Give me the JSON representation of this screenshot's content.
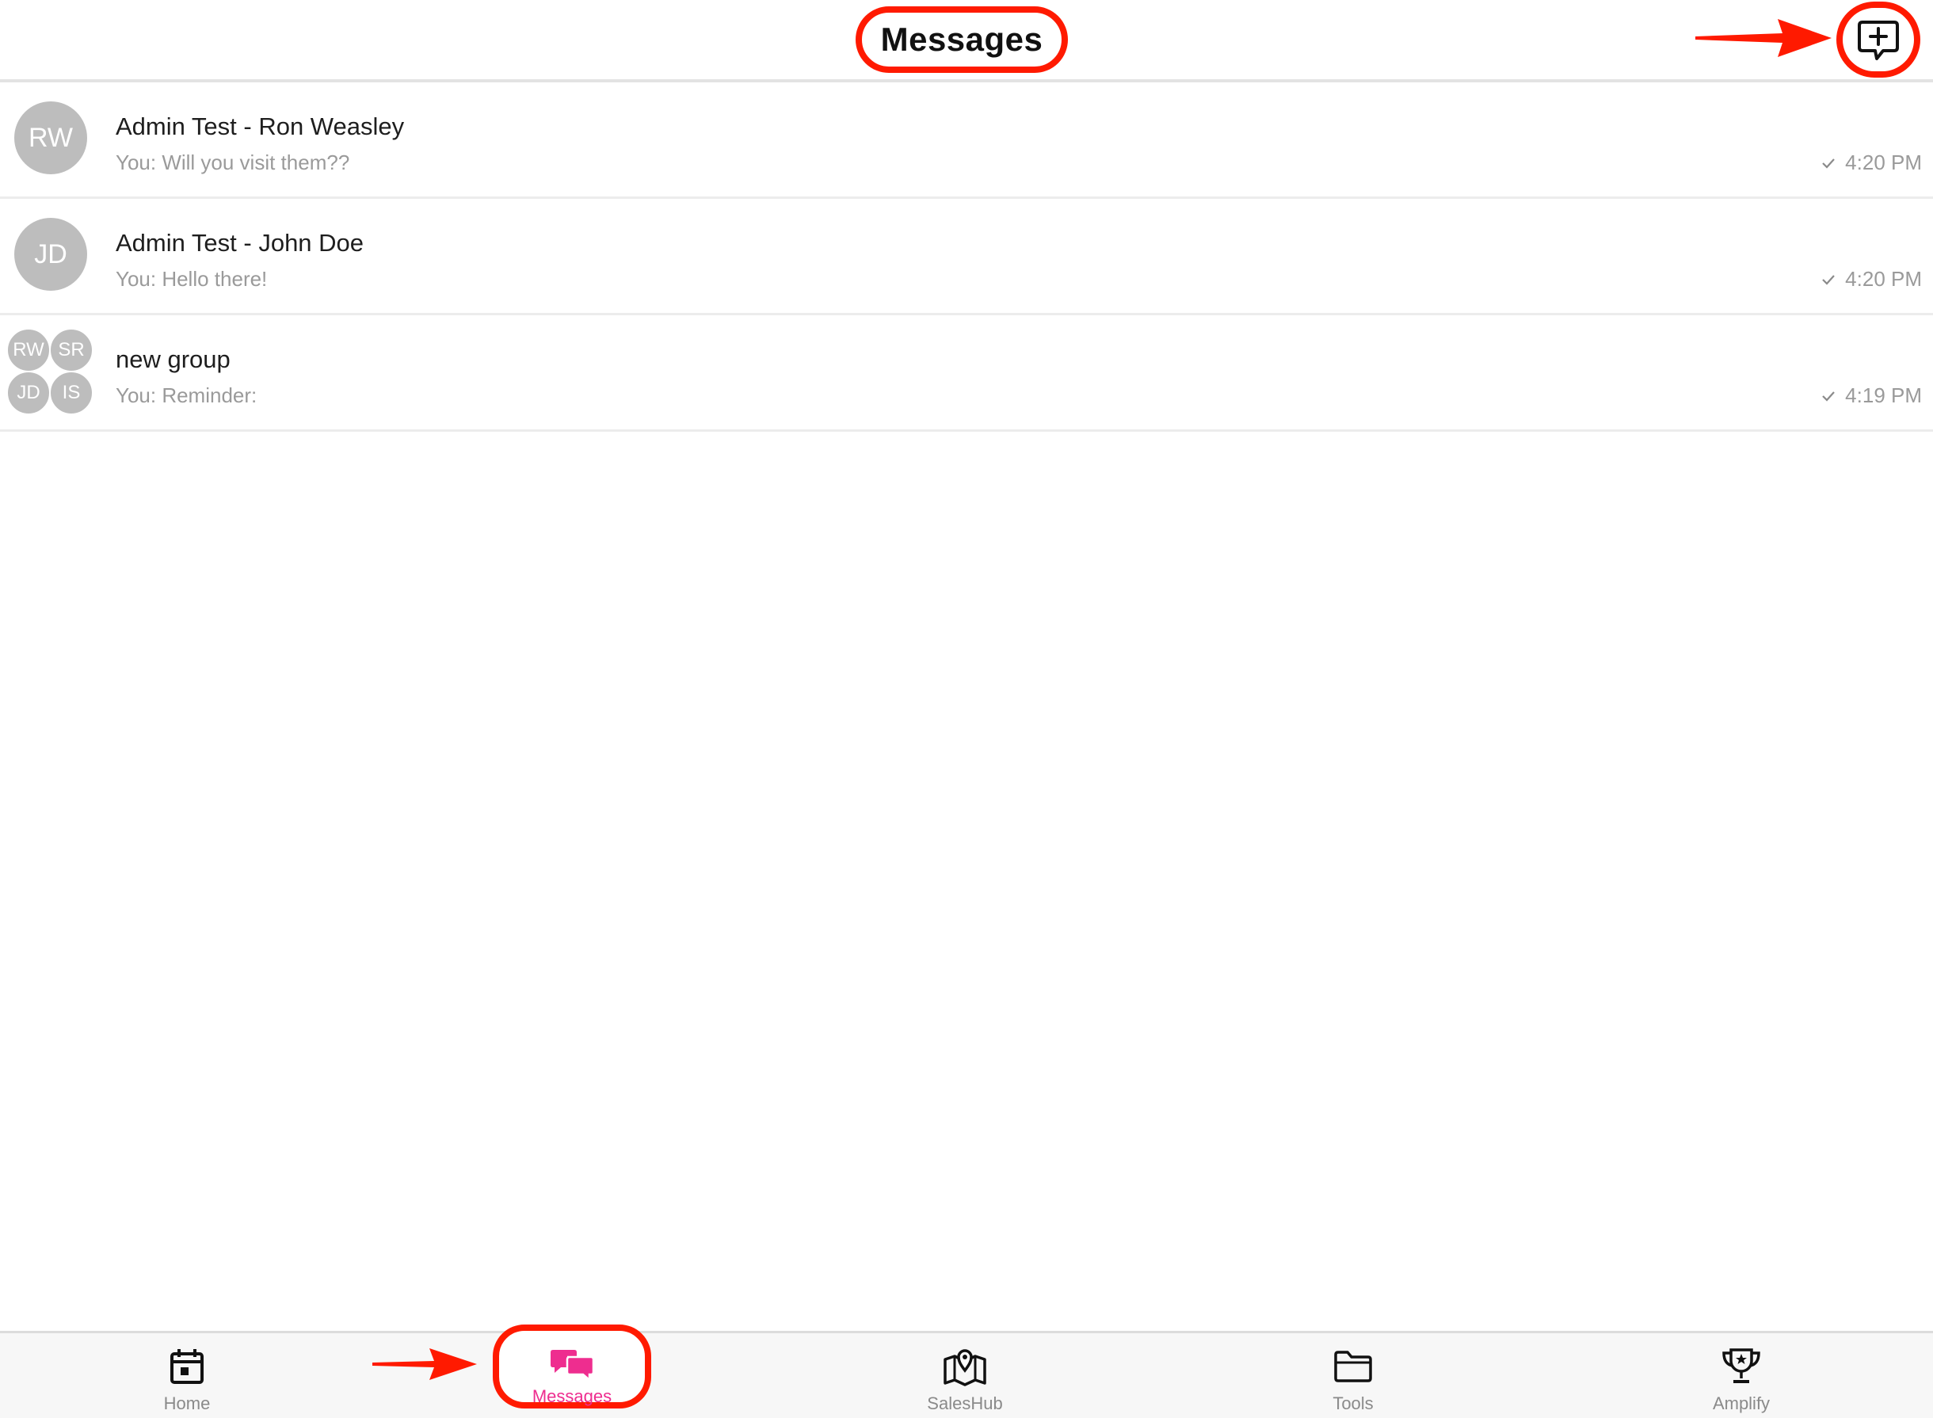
{
  "header": {
    "title": "Messages"
  },
  "conversations": [
    {
      "initials": "RW",
      "name": "Admin Test - Ron Weasley",
      "preview": "You: Will you visit them??",
      "time": "4:20 PM"
    },
    {
      "initials": "JD",
      "name": "Admin Test - John Doe",
      "preview": "You: Hello there!",
      "time": "4:20 PM"
    },
    {
      "group_initials": [
        "RW",
        "SR",
        "JD",
        "IS"
      ],
      "name": "new group",
      "preview": "You: Reminder:",
      "time": "4:19 PM"
    }
  ],
  "tabs": [
    {
      "label": "Home",
      "icon": "calendar-icon"
    },
    {
      "label": "Messages",
      "icon": "chat-bubbles-icon",
      "active": true
    },
    {
      "label": "SalesHub",
      "icon": "map-pin-icon"
    },
    {
      "label": "Tools",
      "icon": "folder-icon"
    },
    {
      "label": "Amplify",
      "icon": "trophy-icon"
    }
  ],
  "colors": {
    "accent": "#ee2d8f",
    "annotation": "#ff1a00",
    "avatar": "#bdbdbd",
    "muted_text": "#9a9a9a"
  }
}
